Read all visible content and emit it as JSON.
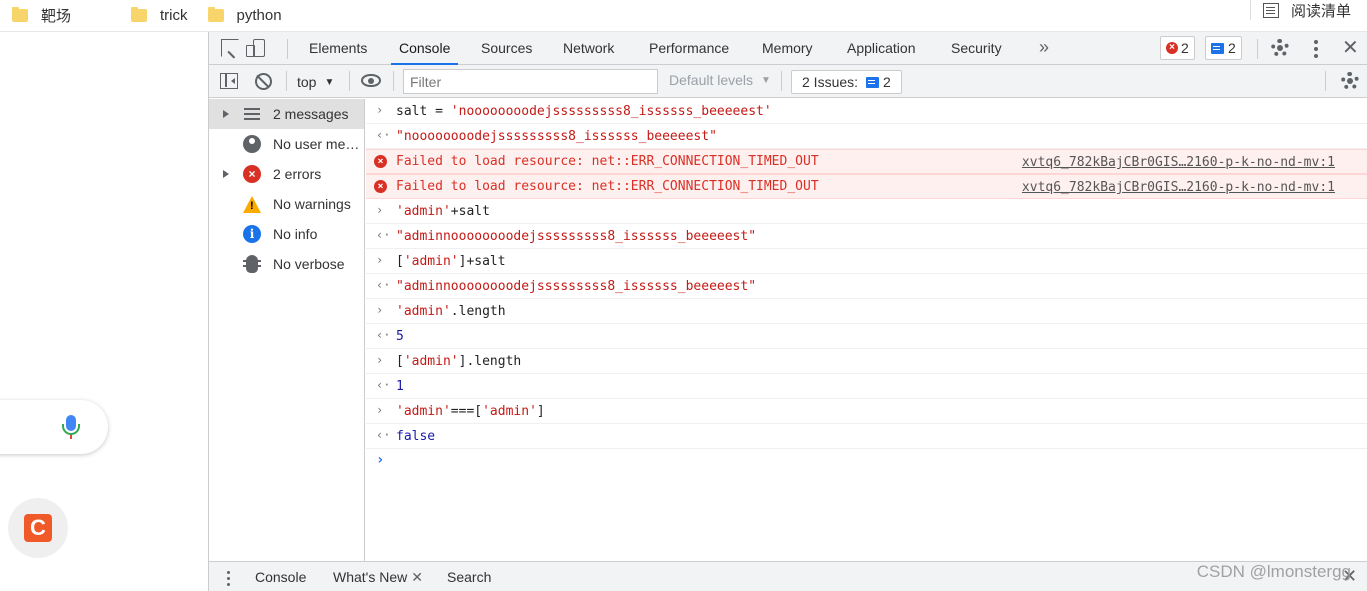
{
  "bookmarks": [
    {
      "label": "靶场"
    },
    {
      "label": "trick"
    },
    {
      "label": "python"
    }
  ],
  "reading_list": {
    "label": "阅读清单",
    "icon": "reading-list-icon"
  },
  "devtools": {
    "tabs": [
      "Elements",
      "Console",
      "Sources",
      "Network",
      "Performance",
      "Memory",
      "Application",
      "Security"
    ],
    "active_tab": "Console",
    "error_count": "2",
    "issue_count": "2",
    "toolbar": {
      "context": "top",
      "filter_placeholder": "Filter",
      "levels": "Default levels",
      "issues_label": "2 Issues:",
      "issues_count": "2"
    },
    "sidebar": [
      {
        "label": "2 messages",
        "icon": "list-icon",
        "expandable": true
      },
      {
        "label": "No user me…",
        "icon": "user-icon",
        "expandable": false
      },
      {
        "label": "2 errors",
        "icon": "error-icon",
        "expandable": true
      },
      {
        "label": "No warnings",
        "icon": "warning-icon",
        "expandable": false
      },
      {
        "label": "No info",
        "icon": "info-icon",
        "expandable": false
      },
      {
        "label": "No verbose",
        "icon": "bug-icon",
        "expandable": false
      }
    ],
    "console": {
      "lines": [
        {
          "kind": "input",
          "parts": [
            {
              "t": "salt = ",
              "c": "code"
            },
            {
              "t": "'noooooooodejsssssssss8_issssss_beeeeest'",
              "c": "str"
            }
          ]
        },
        {
          "kind": "result",
          "parts": [
            {
              "t": "\"noooooooodejsssssssss8_issssss_beeeeest\"",
              "c": "str"
            }
          ]
        },
        {
          "kind": "error",
          "text": "Failed to load resource: net::ERR_CONNECTION_TIMED_OUT",
          "source": "xvtq6_782kBajCBr0GIS…2160-p-k-no-nd-mv:1"
        },
        {
          "kind": "error",
          "text": "Failed to load resource: net::ERR_CONNECTION_TIMED_OUT",
          "source": "xvtq6_782kBajCBr0GIS…2160-p-k-no-nd-mv:1"
        },
        {
          "kind": "input",
          "parts": [
            {
              "t": "'admin'",
              "c": "str"
            },
            {
              "t": "+salt",
              "c": "code"
            }
          ]
        },
        {
          "kind": "result",
          "parts": [
            {
              "t": "\"adminnoooooooodejsssssssss8_issssss_beeeeest\"",
              "c": "str"
            }
          ]
        },
        {
          "kind": "input",
          "parts": [
            {
              "t": "[",
              "c": "code"
            },
            {
              "t": "'admin'",
              "c": "str"
            },
            {
              "t": "]+salt",
              "c": "code"
            }
          ]
        },
        {
          "kind": "result",
          "parts": [
            {
              "t": "\"adminnoooooooodejsssssssss8_issssss_beeeeest\"",
              "c": "str"
            }
          ]
        },
        {
          "kind": "input",
          "parts": [
            {
              "t": "'admin'",
              "c": "str"
            },
            {
              "t": ".length",
              "c": "code"
            }
          ]
        },
        {
          "kind": "result",
          "parts": [
            {
              "t": "5",
              "c": "num"
            }
          ]
        },
        {
          "kind": "input",
          "parts": [
            {
              "t": "[",
              "c": "code"
            },
            {
              "t": "'admin'",
              "c": "str"
            },
            {
              "t": "].length",
              "c": "code"
            }
          ]
        },
        {
          "kind": "result",
          "parts": [
            {
              "t": "1",
              "c": "num"
            }
          ]
        },
        {
          "kind": "input",
          "parts": [
            {
              "t": "'admin'",
              "c": "str"
            },
            {
              "t": "===[",
              "c": "code"
            },
            {
              "t": "'admin'",
              "c": "str"
            },
            {
              "t": "]",
              "c": "code"
            }
          ]
        },
        {
          "kind": "result",
          "parts": [
            {
              "t": "false",
              "c": "kw"
            }
          ]
        }
      ]
    },
    "drawer": {
      "tabs": [
        {
          "label": "Console",
          "closable": false
        },
        {
          "label": "What's New",
          "closable": true
        },
        {
          "label": "Search",
          "closable": false
        }
      ]
    }
  },
  "watermark": "CSDN @lmonstergg",
  "colors": {
    "accent": "#1a73e8",
    "error": "#d93025",
    "string": "#c41a16",
    "number": "#1a1aa6",
    "warning": "#f9ab00"
  }
}
